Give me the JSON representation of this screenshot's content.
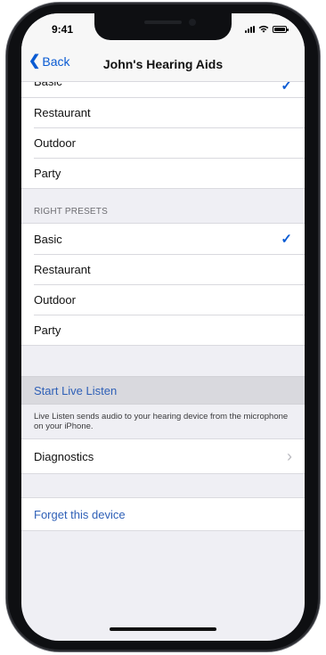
{
  "status_bar": {
    "time": "9:41",
    "icons": [
      "cellular-signal-icon",
      "wifi-icon",
      "battery-icon"
    ]
  },
  "navbar": {
    "back_label": "Back",
    "title": "John's Hearing Aids"
  },
  "left_presets": {
    "partial_item": "Basic",
    "items": [
      "Restaurant",
      "Outdoor",
      "Party"
    ],
    "selected": "Basic"
  },
  "right_presets": {
    "header": "RIGHT PRESETS",
    "items": [
      "Basic",
      "Restaurant",
      "Outdoor",
      "Party"
    ],
    "selected": "Basic"
  },
  "live_listen": {
    "label": "Start Live Listen",
    "footer": "Live Listen sends audio to your hearing device from the microphone on your iPhone."
  },
  "diagnostics": {
    "label": "Diagnostics"
  },
  "forget": {
    "label": "Forget this device"
  },
  "colors": {
    "accent": "#0a5bd3",
    "link": "#2f60b7",
    "background": "#efeff4"
  }
}
